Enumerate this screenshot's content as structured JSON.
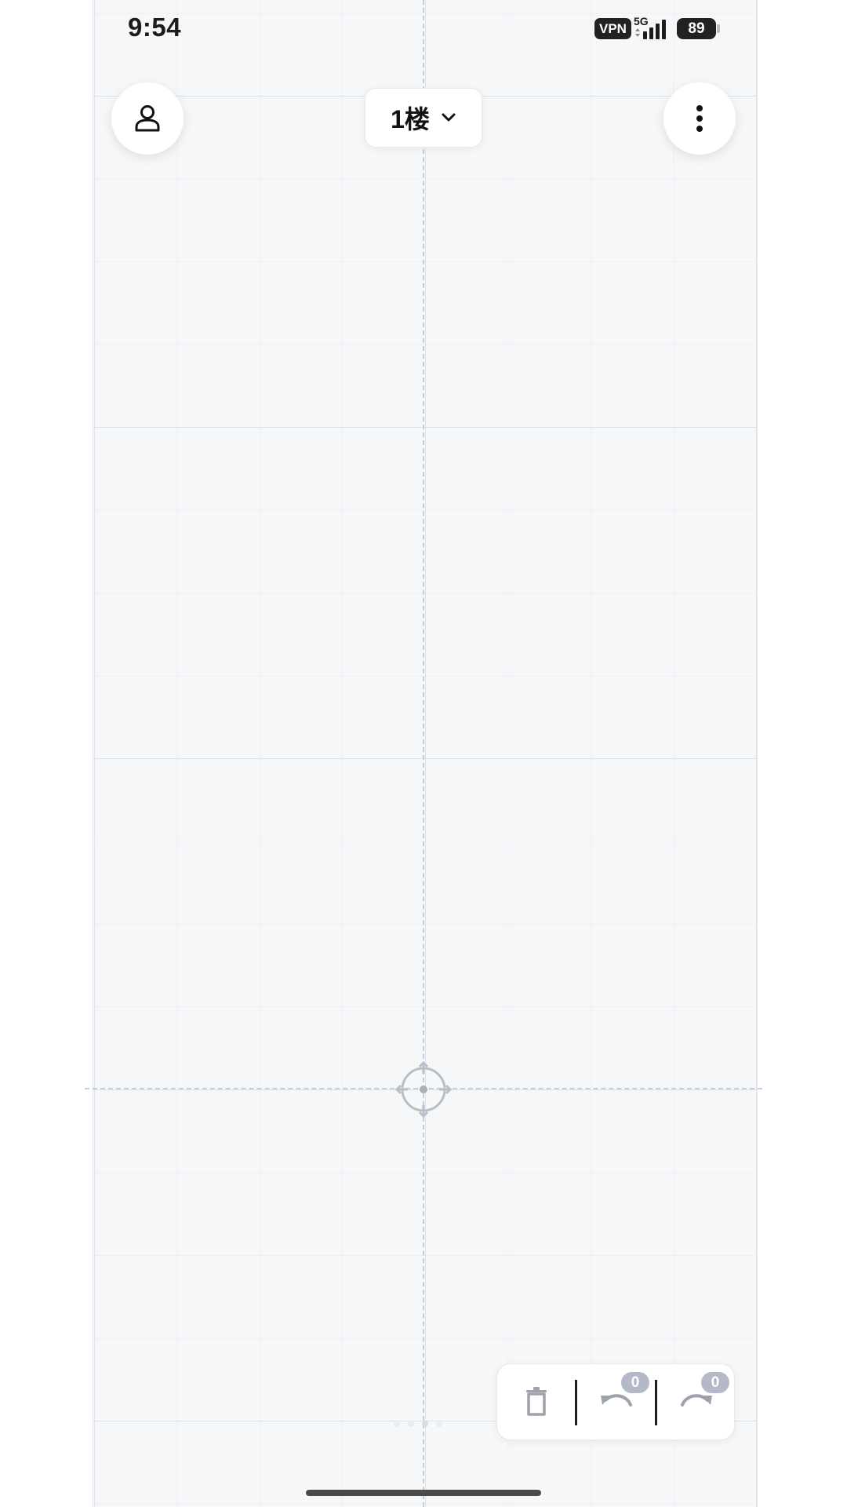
{
  "status_bar": {
    "time": "9:54",
    "vpn": "VPN",
    "network": "5G",
    "battery": "89"
  },
  "header": {
    "floor_selector": {
      "label": "1楼"
    }
  },
  "toolbar": {
    "undo_count": "0",
    "redo_count": "0"
  },
  "icons": {
    "profile": "person-icon",
    "more": "vertical-dots-icon",
    "dropdown": "chevron-down-icon",
    "delete": "trash-icon",
    "undo": "undo-icon",
    "redo": "redo-icon",
    "origin": "crosshair-icon"
  },
  "colors": {
    "canvas_background": "#f6f7f9",
    "grid_line": "#d2d7e0",
    "axis_dashes": "#c7ccd6",
    "badge": "#b3b9c7",
    "icon_disabled": "#9ea3ab"
  }
}
